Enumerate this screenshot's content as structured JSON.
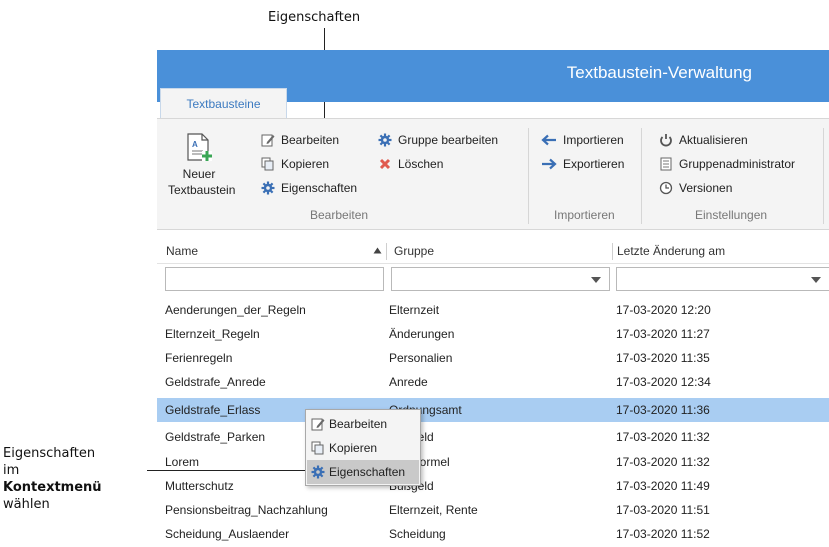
{
  "callouts": {
    "top": "Eigenschaften",
    "left_line1": "Eigenschaften",
    "left_line2": "im",
    "left_line3_bold": "Kontextmenü",
    "left_line4": "wählen"
  },
  "app": {
    "title": "Textbaustein-Verwaltung"
  },
  "tabs": [
    {
      "label": "Textbausteine",
      "active": true
    }
  ],
  "ribbon": {
    "new_button_line1": "Neuer",
    "new_button_line2": "Textbaustein",
    "bearbeiten_group": {
      "items": [
        "Bearbeiten",
        "Kopieren",
        "Eigenschaften",
        "Gruppe bearbeiten",
        "Löschen"
      ],
      "label": "Bearbeiten"
    },
    "importieren_group": {
      "items": [
        "Importieren",
        "Exportieren"
      ],
      "label": "Importieren"
    },
    "einstellungen_group": {
      "items": [
        "Aktualisieren",
        "Gruppenadministrator",
        "Versionen"
      ],
      "label": "Einstellungen"
    }
  },
  "grid": {
    "columns": [
      "Name",
      "Gruppe",
      "Letzte Änderung am"
    ],
    "rows": [
      [
        "Aenderungen_der_Regeln",
        "Elternzeit",
        "17-03-2020 12:20"
      ],
      [
        "Elternzeit_Regeln",
        "Änderungen",
        "17-03-2020 11:27"
      ],
      [
        "Ferienregeln",
        "Personalien",
        "17-03-2020 11:35"
      ],
      [
        "Geldstrafe_Anrede",
        "Anrede",
        "17-03-2020 12:34"
      ],
      [
        "Geldstrafe_Erlass",
        "Ordnungsamt",
        "17-03-2020 11:36"
      ],
      [
        "Geldstrafe_Parken",
        "Bußgeld",
        "17-03-2020 11:32"
      ],
      [
        "Lorem",
        "Grußformel",
        "17-03-2020 11:32"
      ],
      [
        "Mutterschutz",
        "Bußgeld",
        "17-03-2020 11:49"
      ],
      [
        "Pensionsbeitrag_Nachzahlung",
        "Elternzeit, Rente",
        "17-03-2020 11:51"
      ],
      [
        "Scheidung_Auslaender",
        "Scheidung",
        "17-03-2020 11:52"
      ]
    ],
    "selected_row": 4
  },
  "context_menu": {
    "items": [
      "Bearbeiten",
      "Kopieren",
      "Eigenschaften"
    ],
    "highlighted": 2
  },
  "colors": {
    "title_bar": "#4a90d9",
    "selection": "#a9cdf2",
    "tab_text": "#3c7ac0",
    "delete_icon": "#e05a4f",
    "gear_icon": "#3a6fb5"
  }
}
